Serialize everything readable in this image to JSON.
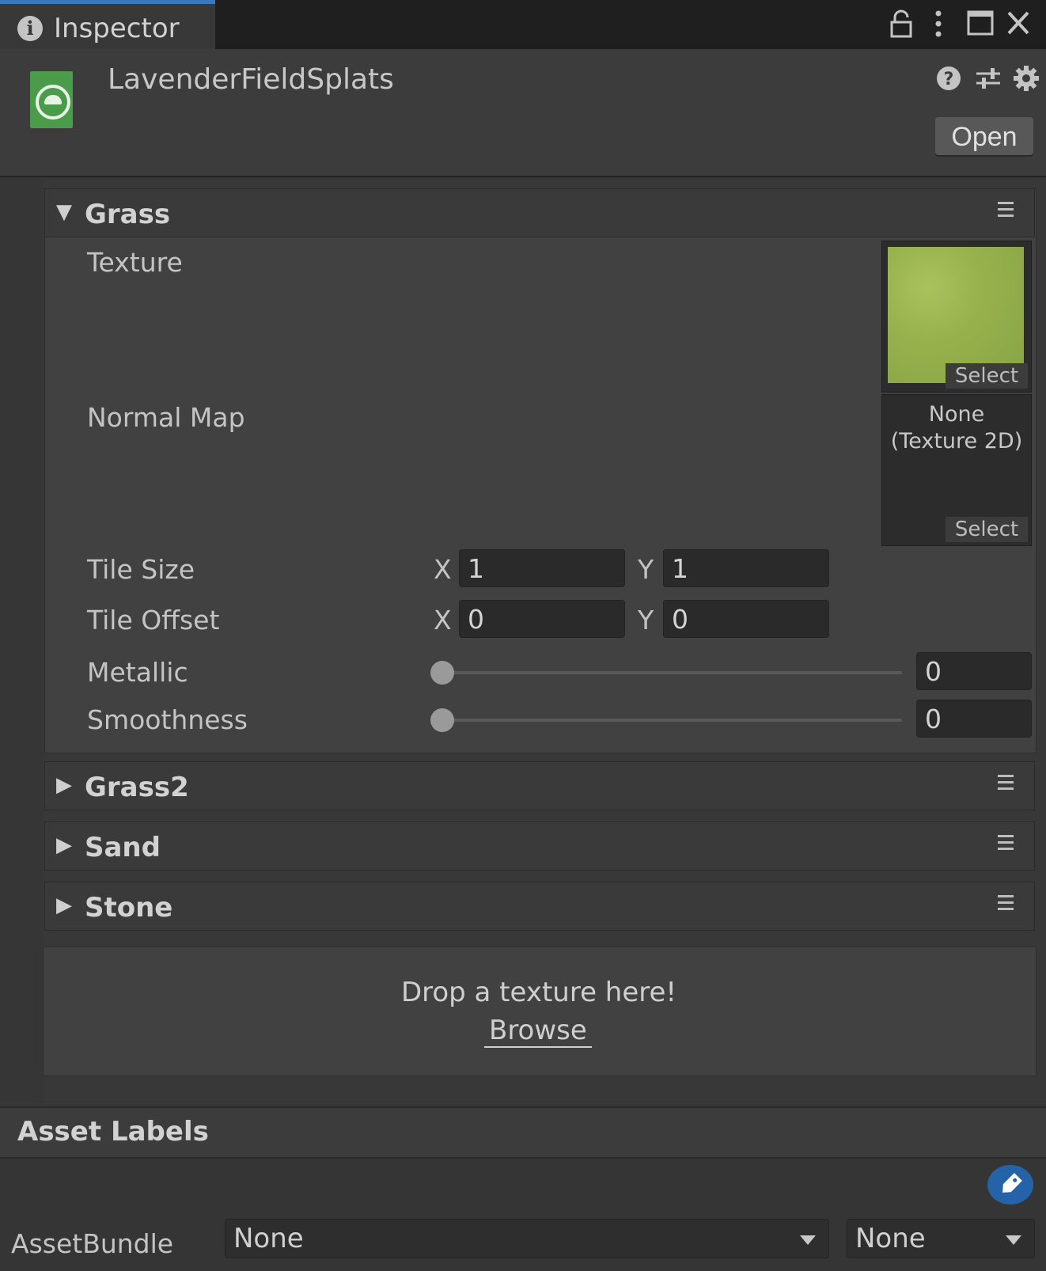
{
  "window": {
    "tab_title": "Inspector"
  },
  "header": {
    "asset_name": "LavenderFieldSplats",
    "open_label": "Open"
  },
  "layers": [
    {
      "name": "Grass",
      "expanded": true,
      "fields": {
        "texture_label": "Texture",
        "texture_select": "Select",
        "normal_map_label": "Normal Map",
        "normal_map_value_line1": "None",
        "normal_map_value_line2": "(Texture 2D)",
        "normal_map_select": "Select",
        "tile_size_label": "Tile Size",
        "tile_size_x_label": "X",
        "tile_size_x": "1",
        "tile_size_y_label": "Y",
        "tile_size_y": "1",
        "tile_offset_label": "Tile Offset",
        "tile_offset_x_label": "X",
        "tile_offset_x": "0",
        "tile_offset_y_label": "Y",
        "tile_offset_y": "0",
        "metallic_label": "Metallic",
        "metallic_value": "0",
        "smoothness_label": "Smoothness",
        "smoothness_value": "0"
      }
    },
    {
      "name": "Grass2",
      "expanded": false
    },
    {
      "name": "Sand",
      "expanded": false
    },
    {
      "name": "Stone",
      "expanded": false
    }
  ],
  "dropzone": {
    "text": "Drop a texture here!",
    "browse_label": "Browse"
  },
  "asset_labels": {
    "title": "Asset Labels",
    "assetbundle_label": "AssetBundle",
    "assetbundle_value": "None",
    "variant_value": "None"
  },
  "colors": {
    "background": "#383838",
    "tab_accent": "#3a79bb",
    "asset_icon": "#4a9b4a",
    "tag_button": "#2463a8",
    "grass_texture": "#9bb64f"
  },
  "icons": [
    "info-icon",
    "lock-icon",
    "more-icon",
    "maximize-icon",
    "close-icon",
    "help-icon",
    "preset-icon",
    "settings-icon",
    "terrain-layer-icon",
    "tag-icon"
  ]
}
